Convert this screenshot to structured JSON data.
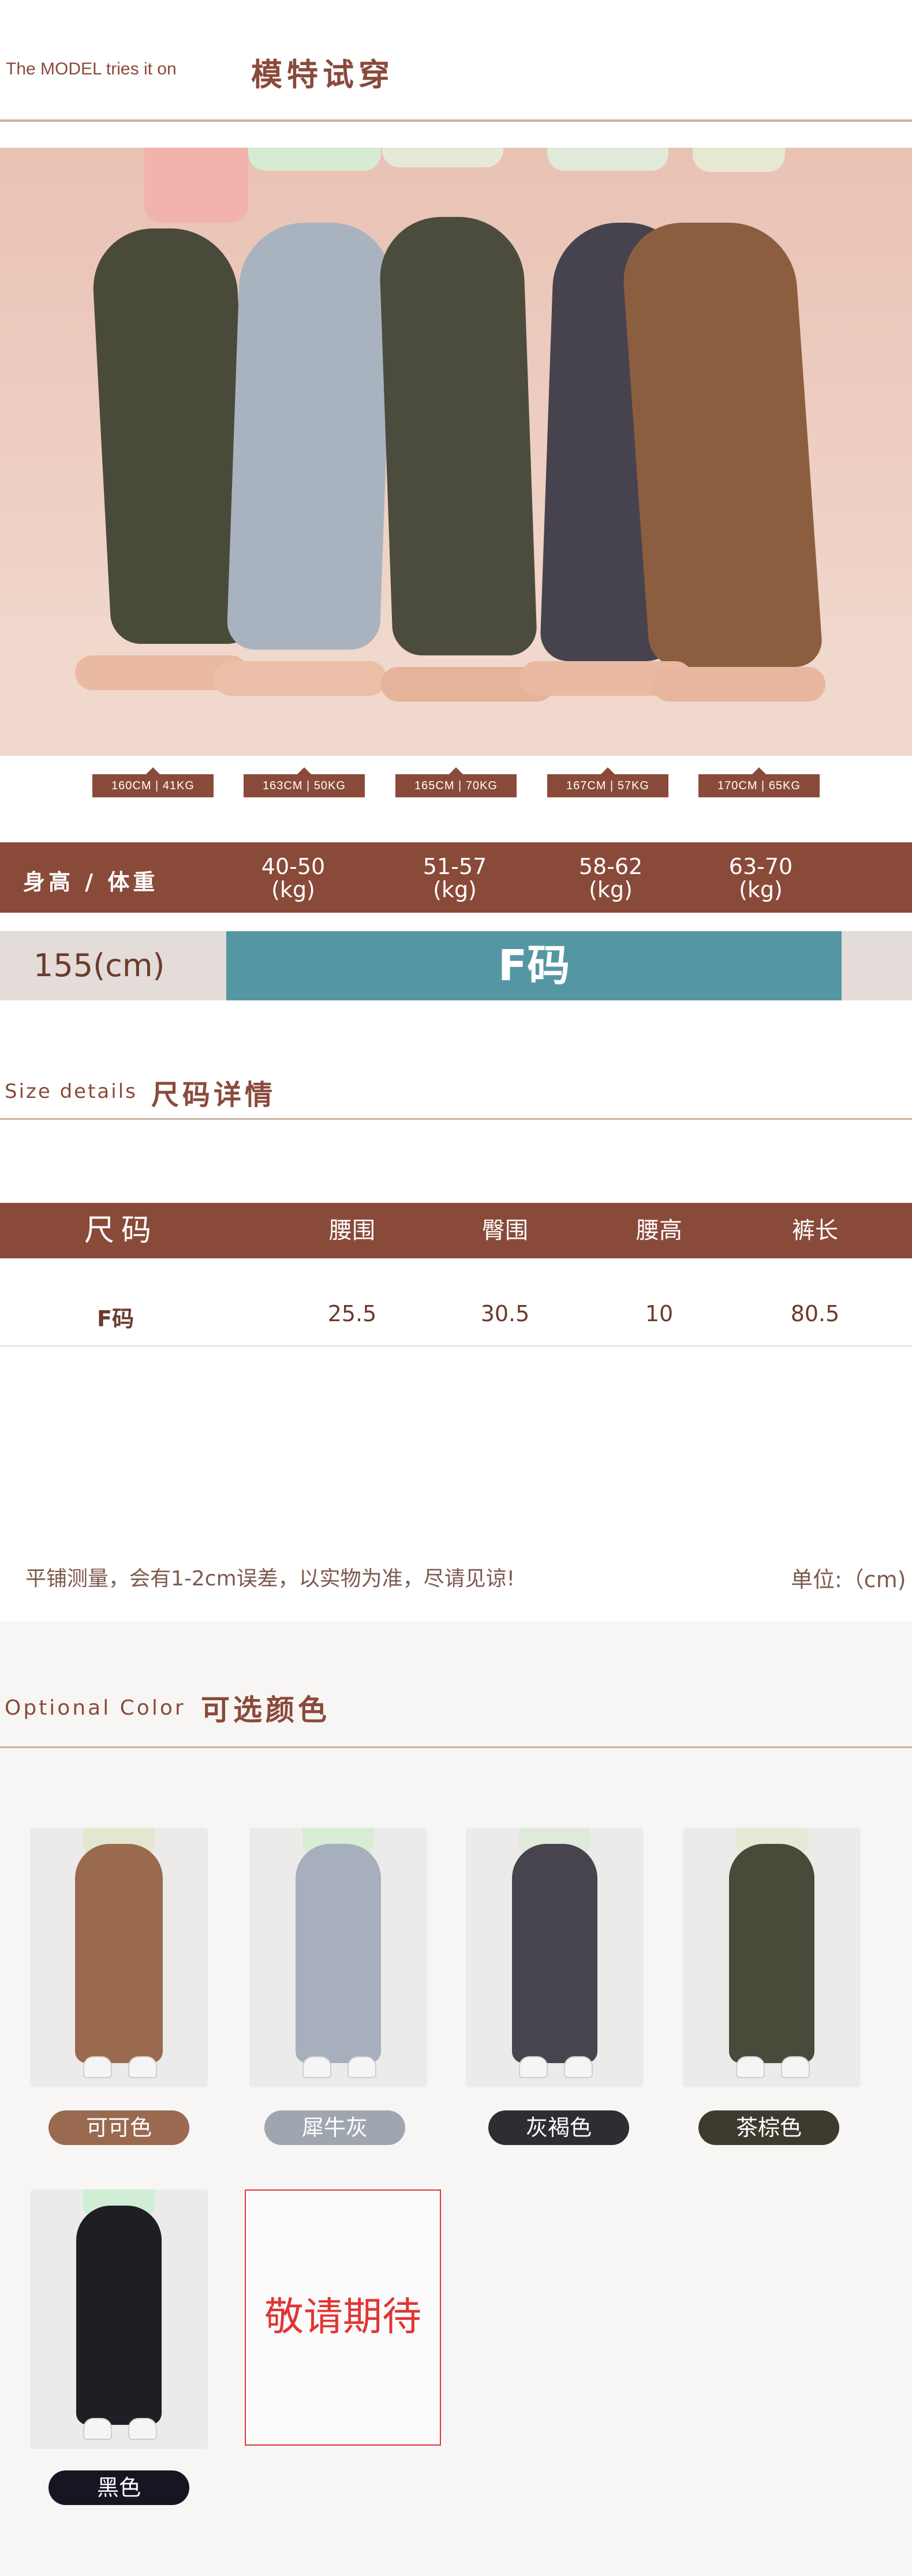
{
  "model_section": {
    "title_en": "The MODEL tries it on",
    "title_zh": "模特试穿",
    "models": [
      {
        "label": "160CM | 41KG",
        "color": "#4a4a3a"
      },
      {
        "label": "163CM | 50KG",
        "color": "#a8b3bf"
      },
      {
        "label": "165CM | 70KG",
        "color": "#4b4c3d"
      },
      {
        "label": "167CM | 57KG",
        "color": "#46434e"
      },
      {
        "label": "170CM | 65KG",
        "color": "#8c5e40"
      }
    ]
  },
  "size_chart": {
    "header_label": "身高 / 体重",
    "columns": [
      {
        "top": "40-50",
        "bottom": "(kg)"
      },
      {
        "top": "51-57",
        "bottom": "(kg)"
      },
      {
        "top": "58-62",
        "bottom": "(kg)"
      },
      {
        "top": "63-70",
        "bottom": "(kg)"
      }
    ],
    "height_label": "155(cm)",
    "size_label": "F码"
  },
  "size_details": {
    "title_en": "Size details",
    "title_zh": "尺码详情",
    "headers": [
      "尺码",
      "腰围",
      "臀围",
      "腰高",
      "裤长"
    ],
    "rows": [
      [
        "F码",
        "25.5",
        "30.5",
        "10",
        "80.5"
      ]
    ],
    "note": "平铺测量，会有1-2cm误差，以实物为准，尽请见谅!",
    "unit": "单位:（cm)"
  },
  "optional_colors": {
    "title_en": "Optional Color",
    "title_zh": "可选颜色",
    "items": [
      {
        "name": "可可色",
        "pill_color": "#9a6a50",
        "legging_color": "#9a6a4e",
        "top_color": "#e4e6cf"
      },
      {
        "name": "犀牛灰",
        "pill_color": "#a0a6b0",
        "legging_color": "#a6afbb",
        "top_color": "#d9ecd4"
      },
      {
        "name": "灰褐色",
        "pill_color": "#2f2d31",
        "legging_color": "#48444e",
        "top_color": "#e0eadb"
      },
      {
        "name": "茶棕色",
        "pill_color": "#3d3b2e",
        "legging_color": "#4a4a3a",
        "top_color": "#e6e9d3"
      },
      {
        "name": "黑色",
        "pill_color": "#151622",
        "legging_color": "#1e1e24",
        "top_color": "#cfeed5"
      }
    ],
    "coming_soon": "敬请期待"
  }
}
